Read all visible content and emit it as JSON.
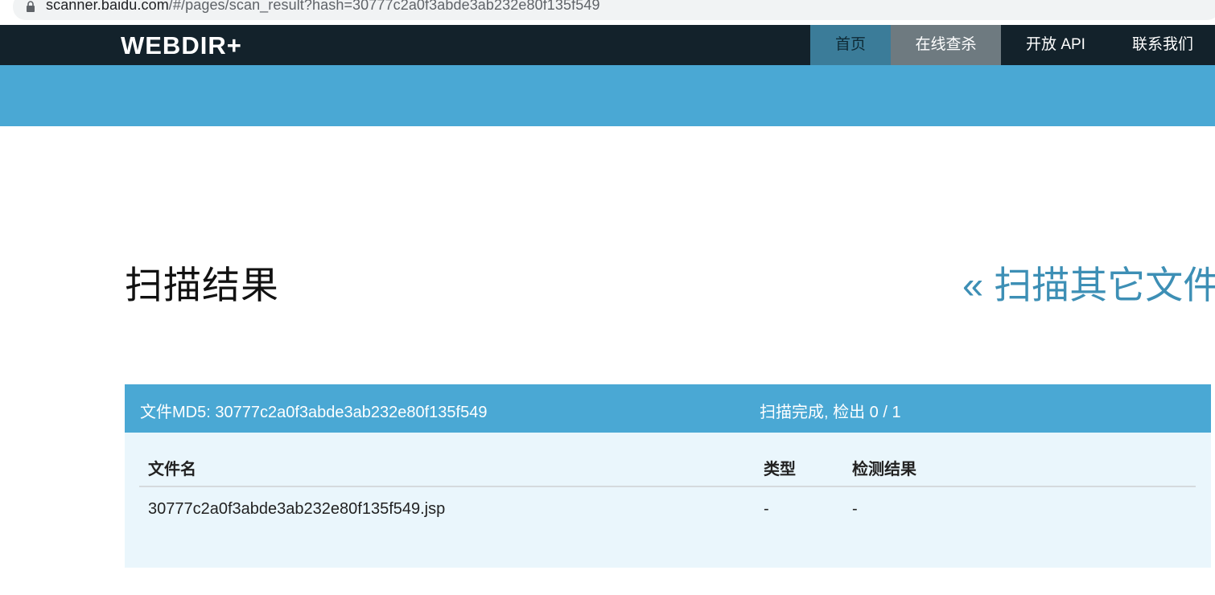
{
  "browser": {
    "url_host": "scanner.baidu.com",
    "url_path": "/#/pages/scan_result?hash=30777c2a0f3abde3ab232e80f135f549"
  },
  "nav": {
    "brand": "WEBDIR+",
    "items": [
      {
        "label": "首页",
        "active": true
      },
      {
        "label": "在线查杀"
      },
      {
        "label": "开放 API"
      },
      {
        "label": "联系我们"
      }
    ]
  },
  "main": {
    "title": "扫描结果",
    "back_link": "« 扫描其它文件"
  },
  "result": {
    "md5_label": "文件MD5: ",
    "md5": "30777c2a0f3abde3ab232e80f135f549",
    "status_label": "扫描完成, 检出 ",
    "status_count": "0 / 1",
    "columns": [
      "文件名",
      "类型",
      "检测结果"
    ],
    "rows": [
      {
        "name": "30777c2a0f3abde3ab232e80f135f549.jsp",
        "type": "-",
        "result": "-"
      }
    ]
  },
  "colors": {
    "navbar": "#13222b",
    "banner": "#4aa8d4",
    "active_tab": "#3b7c99",
    "link": "#3d8fb5",
    "panel_bg": "#eaf6fc"
  }
}
